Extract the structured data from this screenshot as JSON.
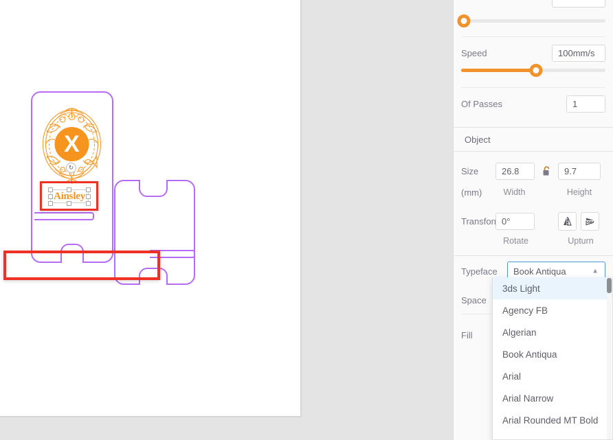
{
  "workspace": {
    "canvas_label": "design-canvas",
    "text_object": {
      "value": "Ainsley",
      "color": "#f7941e"
    },
    "emblem": {
      "letter": "X",
      "color": "#f7941e"
    },
    "shape_color": "#b46bf5",
    "annotation_color": "#ee3124"
  },
  "panel": {
    "power_slider": {
      "value": 0,
      "name": "power-slider"
    },
    "speed": {
      "label": "Speed",
      "value": "100mm/s",
      "slider_value": 50
    },
    "passes": {
      "label": "Of Passes",
      "value": "1"
    },
    "object": {
      "section_title": "Object",
      "size_label": "Size",
      "unit_label": "(mm)",
      "width_value": "26.8",
      "width_label": "Width",
      "height_value": "9.7",
      "height_label": "Height",
      "lock_icon": "unlock-icon",
      "transform_label": "Transform",
      "rotate_value": "0°",
      "rotate_label": "Rotate",
      "upturn_label": "Upturn",
      "flip_vertical_icon": "flip-vertical-icon",
      "flip_horizontal_icon": "flip-horizontal-icon"
    },
    "typeface": {
      "label": "Typeface",
      "selected": "Book Antiqua",
      "caret_icon": "chevron-up-icon",
      "options": [
        "3ds Light",
        "Agency FB",
        "Algerian",
        "Book Antiqua",
        "Arial",
        "Arial Narrow",
        "Arial Rounded MT Bold"
      ],
      "highlighted_option": "3ds Light"
    },
    "space": {
      "label": "Space"
    },
    "fill": {
      "label": "Fill",
      "swatch_color": "#1a8fe0"
    },
    "accent_color": "#f2922c",
    "select_border_color": "#4a9ae2"
  }
}
